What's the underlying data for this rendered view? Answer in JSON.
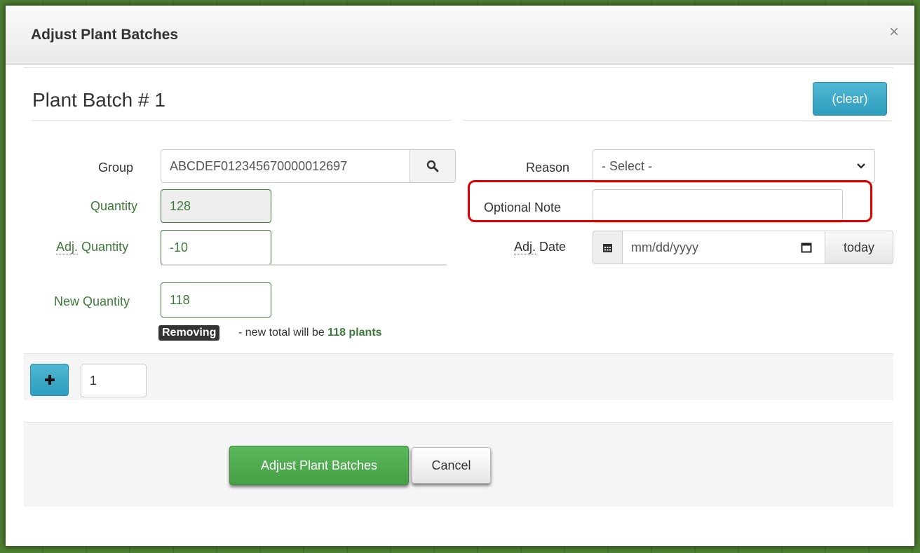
{
  "modal": {
    "title": "Adjust Plant Batches",
    "close_glyph": "×"
  },
  "batch": {
    "title": "Plant Batch # 1",
    "clear_label": "(clear)"
  },
  "form": {
    "group_label": "Group",
    "group_value": "ABCDEF012345670000012697",
    "quantity_label": "Quantity",
    "quantity_value": "128",
    "adj_quantity_label_abbr": "Adj.",
    "adj_quantity_label_rest": " Quantity",
    "adj_quantity_value": "-10",
    "new_quantity_label": "New Quantity",
    "new_quantity_value": "118",
    "reason_label": "Reason",
    "reason_selected": "- Select -",
    "optional_note_label": "Optional Note",
    "optional_note_value": "",
    "adj_date_label_abbr": "Adj.",
    "adj_date_label_rest": " Date",
    "adj_date_placeholder": "mm/dd/yyyy",
    "today_label": "today"
  },
  "summary": {
    "badge": "Removing",
    "text_prefix": " - new total will be ",
    "text_strong": "118 plants"
  },
  "repeat": {
    "count_value": "1"
  },
  "footer": {
    "primary_label": "Adjust Plant Batches",
    "cancel_label": "Cancel"
  },
  "colors": {
    "accent_info": "#31a3c4",
    "success": "#5cb85c",
    "field_green": "#3c7a3a",
    "highlight": "#e00000"
  }
}
